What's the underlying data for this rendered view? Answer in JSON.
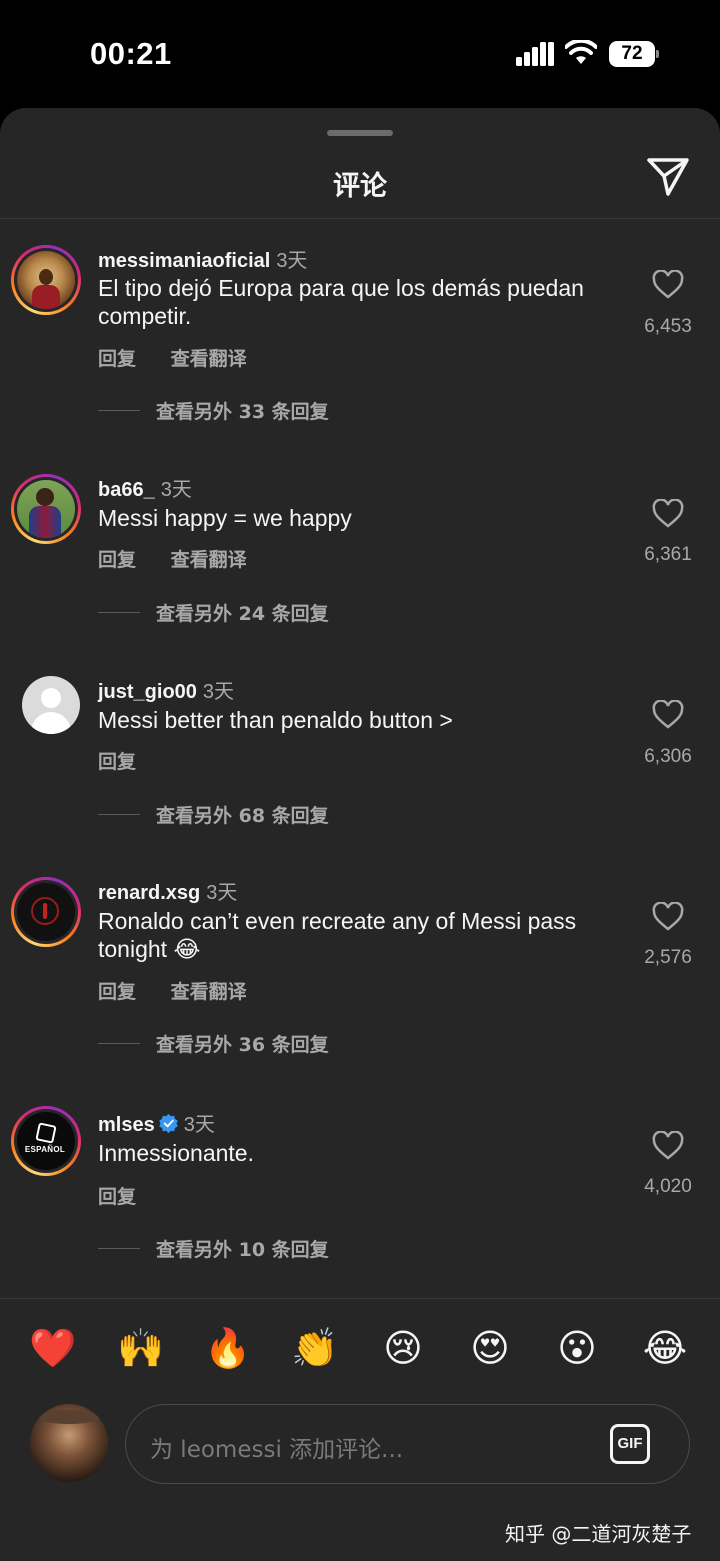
{
  "status_bar": {
    "time": "00:21",
    "battery": "72"
  },
  "sheet": {
    "title": "评论"
  },
  "comments": [
    {
      "username": "messimaniaoficial",
      "time": "3天",
      "text": "El tipo dejó Europa para que los demás puedan competir.",
      "actions": [
        "回复",
        "查看翻译"
      ],
      "replies": "查看另外 33 条回复",
      "likes": "6,453",
      "verified": false
    },
    {
      "username": "ba66_",
      "time": "3天",
      "text": "Messi happy = we happy",
      "actions": [
        "回复",
        "查看翻译"
      ],
      "replies": "查看另外 24 条回复",
      "likes": "6,361",
      "verified": false
    },
    {
      "username": "just_gio00",
      "time": "3天",
      "text": "Messi better than penaldo button >",
      "actions": [
        "回复"
      ],
      "replies": "查看另外 68 条回复",
      "likes": "6,306",
      "verified": false
    },
    {
      "username": "renard.xsg",
      "time": "3天",
      "text": "Ronaldo can’t even recreate any of Messi pass tonight 😂",
      "actions": [
        "回复",
        "查看翻译"
      ],
      "replies": "查看另外 36 条回复",
      "likes": "2,576",
      "verified": false
    },
    {
      "username": "mlses",
      "time": "3天",
      "text": "Inmessionante.",
      "actions": [
        "回复"
      ],
      "replies": "查看另外 10 条回复",
      "likes": "4,020",
      "verified": true
    }
  ],
  "avatars": {
    "mlses_logo_text": "ESPAÑOL"
  },
  "emoji_bar": [
    "❤️",
    "🙌",
    "🔥",
    "👏",
    "😢",
    "😍",
    "😮",
    "😂"
  ],
  "composer": {
    "placeholder": "为 leomessi 添加评论...",
    "gif_label": "GIF"
  },
  "watermark": "知乎 @二道河灰楚子",
  "colors": {
    "sheet_bg": "#262626",
    "text": "#f5f5f5",
    "secondary": "#a8a8a8",
    "verified": "#3897f0"
  }
}
